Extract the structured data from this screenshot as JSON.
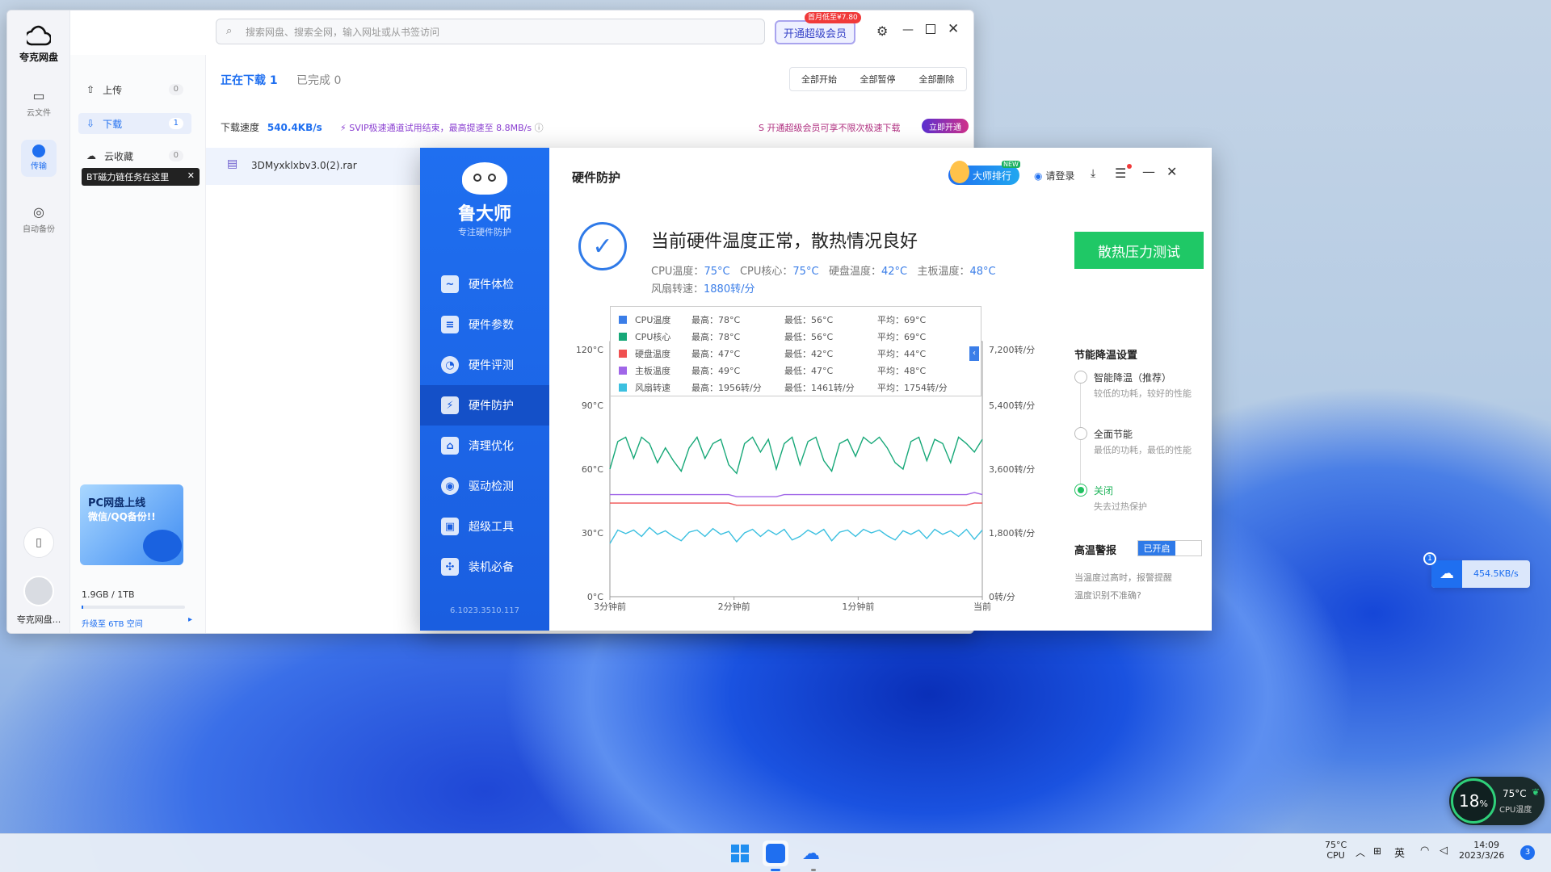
{
  "quark": {
    "brand": "夸克网盘",
    "rail": [
      {
        "label": "云文件",
        "icon": "folder-icon"
      },
      {
        "label": "传输",
        "icon": "transfer-icon"
      },
      {
        "label": "自动备份",
        "icon": "backup-icon"
      }
    ],
    "search_placeholder": "搜索网盘、搜索全网，输入网址或从书签访问",
    "promo_badge": "首月低至¥7.80",
    "vip_button": "开通超级会员",
    "side": {
      "upload": {
        "label": "上传",
        "count": "0"
      },
      "download": {
        "label": "下载",
        "count": "1"
      },
      "cloud": {
        "label": "云收藏",
        "count": "0"
      },
      "tooltip": "BT磁力链任务在这里",
      "banner_line1": "PC网盘上线",
      "banner_line2": "微信/QQ备份!!",
      "storage": "1.9GB / 1TB",
      "upgrade": "升级至 6TB 空间",
      "user": "夸克网盘..."
    },
    "tabs": {
      "downloading": "正在下载",
      "downloading_count": "1",
      "done": "已完成",
      "done_count": "0"
    },
    "actions": {
      "start_all": "全部开始",
      "pause_all": "全部暂停",
      "delete_all": "全部删除"
    },
    "speed_label": "下载速度",
    "speed_value": "540.4KB/s",
    "svip_notice": "SVIP极速通道试用结束，最高提速至 8.8MB/s",
    "svip_promo": "开通超级会员可享不限次极速下载",
    "open_now": "立即开通",
    "file_name": "3DMyxklxbv3.0(2).rar"
  },
  "lu": {
    "logo": "鲁大师",
    "slogan": "专注硬件防护",
    "version": "6.1023.3510.117",
    "nav": [
      "硬件体检",
      "硬件参数",
      "硬件评测",
      "硬件防护",
      "清理优化",
      "驱动检测",
      "超级工具",
      "装机必备"
    ],
    "title": "硬件防护",
    "ranking": "大师排行",
    "new_badge": "NEW",
    "login": "请登录",
    "status_title": "当前硬件温度正常，散热情况良好",
    "readings": {
      "cpu_temp_label": "CPU温度：",
      "cpu_temp": "75°C",
      "cpu_core_label": "CPU核心：",
      "cpu_core": "75°C",
      "disk_label": "硬盘温度：",
      "disk": "42°C",
      "board_label": "主板温度：",
      "board": "48°C",
      "fan_label": "风扇转速：",
      "fan": "1880转/分"
    },
    "stress_button": "散热压力测试",
    "energy_title": "节能降温设置",
    "options": [
      {
        "label": "智能降温（推荐）",
        "desc": "较低的功耗，较好的性能"
      },
      {
        "label": "全面节能",
        "desc": "最低的功耗，最低的性能"
      },
      {
        "label": "关闭",
        "desc": "失去过热保护"
      }
    ],
    "alarm_title": "高温警报",
    "alarm_state": "已开启",
    "alarm_desc": "当温度过高时，报警提醒",
    "alarm_link": "温度识别不准确?"
  },
  "chart_data": {
    "type": "line",
    "x_ticks": [
      "3分钟前",
      "2分钟前",
      "1分钟前",
      "当前"
    ],
    "y_left_ticks": [
      "0°C",
      "30°C",
      "60°C",
      "90°C",
      "120°C"
    ],
    "y_right_ticks": [
      "0转/分",
      "1,800转/分",
      "3,600转/分",
      "5,400转/分",
      "7,200转/分"
    ],
    "ylim": [
      0,
      120
    ],
    "ylim_right": [
      0,
      7200
    ],
    "legend": [
      {
        "name": "CPU温度",
        "max": "最高：78°C",
        "min": "最低：56°C",
        "avg": "平均：69°C",
        "color": "#3b7ee8"
      },
      {
        "name": "CPU核心",
        "max": "最高：78°C",
        "min": "最低：56°C",
        "avg": "平均：69°C",
        "color": "#17a878"
      },
      {
        "name": "硬盘温度",
        "max": "最高：47°C",
        "min": "最低：42°C",
        "avg": "平均：44°C",
        "color": "#f05050"
      },
      {
        "name": "主板温度",
        "max": "最高：49°C",
        "min": "最低：47°C",
        "avg": "平均：48°C",
        "color": "#a066e8"
      },
      {
        "name": "风扇转速",
        "max": "最高：1956转/分",
        "min": "最低：1461转/分",
        "avg": "平均：1754转/分",
        "color": "#3cc0e0"
      }
    ],
    "series": [
      {
        "name": "CPU核心",
        "axis": "left",
        "color": "#17a878",
        "values": [
          60,
          73,
          75,
          65,
          75,
          72,
          63,
          70,
          64,
          59,
          70,
          75,
          65,
          72,
          74,
          62,
          58,
          72,
          75,
          68,
          74,
          60,
          72,
          75,
          62,
          73,
          75,
          64,
          59,
          72,
          74,
          66,
          75,
          72,
          75,
          70,
          63,
          60,
          73,
          75,
          64,
          74,
          72,
          63,
          75,
          72,
          68,
          74
        ]
      },
      {
        "name": "主板温度",
        "axis": "left",
        "color": "#a066e8",
        "values": [
          48,
          48,
          48,
          48,
          48,
          48,
          48,
          48,
          48,
          48,
          48,
          48,
          48,
          48,
          48,
          48,
          47,
          47,
          47,
          47,
          47,
          47,
          48,
          48,
          48,
          48,
          48,
          48,
          48,
          48,
          48,
          48,
          48,
          48,
          48,
          48,
          48,
          48,
          48,
          48,
          48,
          48,
          48,
          48,
          48,
          48,
          49,
          48
        ]
      },
      {
        "name": "硬盘温度",
        "axis": "left",
        "color": "#f05050",
        "values": [
          44,
          44,
          44,
          44,
          44,
          44,
          44,
          44,
          44,
          44,
          44,
          44,
          44,
          44,
          44,
          44,
          43,
          43,
          43,
          43,
          43,
          43,
          43,
          43,
          43,
          43,
          43,
          43,
          43,
          43,
          43,
          43,
          43,
          43,
          43,
          43,
          43,
          43,
          43,
          43,
          43,
          43,
          43,
          43,
          43,
          43,
          44,
          44
        ]
      },
      {
        "name": "风扇转速",
        "axis": "right",
        "color": "#3cc0e0",
        "values": [
          1500,
          1880,
          1780,
          1880,
          1700,
          1950,
          1760,
          1860,
          1700,
          1580,
          1820,
          1880,
          1700,
          1920,
          1760,
          1840,
          1550,
          1800,
          1900,
          1700,
          1880,
          1750,
          1900,
          1600,
          1700,
          1880,
          1760,
          1900,
          1580,
          1820,
          1880,
          1700,
          1900,
          1800,
          1880,
          1720,
          1600,
          1860,
          1760,
          1880,
          1640,
          1900,
          1760,
          1860,
          1700,
          1900,
          1620,
          1880
        ]
      }
    ]
  },
  "widget": {
    "badge": "1",
    "speed": "454.5KB/s"
  },
  "cpu_widget": {
    "load": "18",
    "load_unit": "%",
    "temp": "75°C",
    "label": "CPU温度"
  },
  "taskbar": {
    "cpu_temp": "75°C",
    "cpu_label": "CPU",
    "lang": "英",
    "time": "14:09",
    "date": "2023/3/26",
    "notif": "3"
  }
}
